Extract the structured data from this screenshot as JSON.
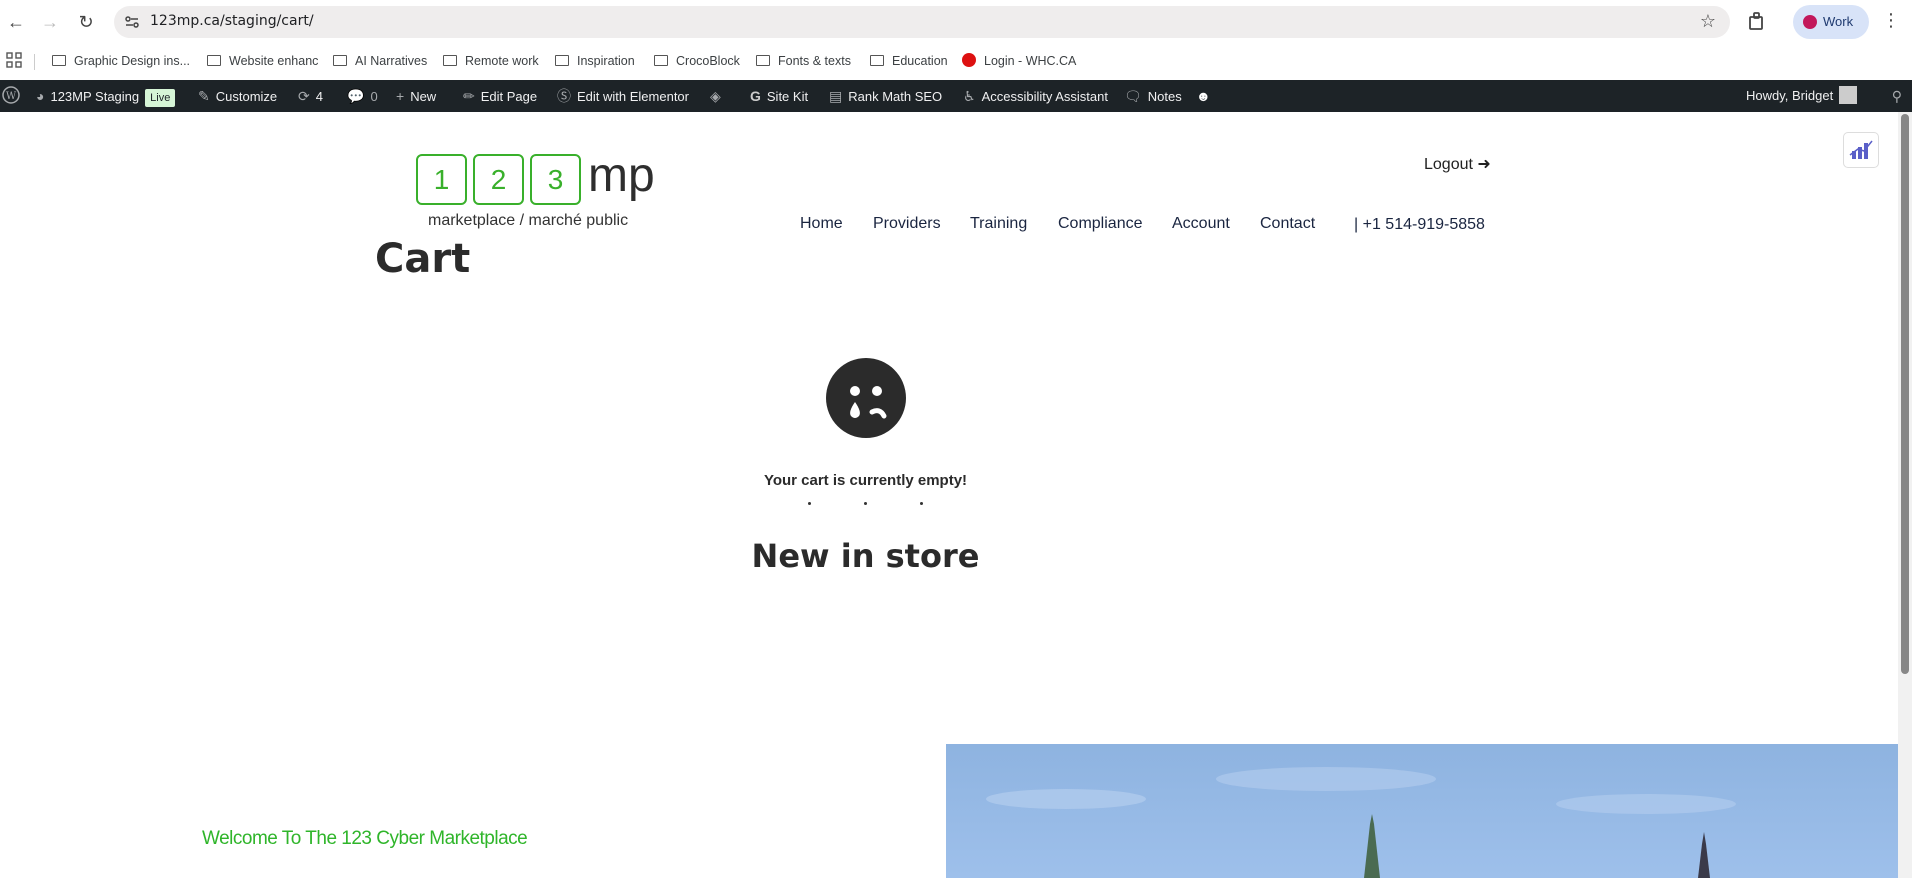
{
  "browser": {
    "url": "123mp.ca/staging/cart/",
    "profile_label": "Work"
  },
  "bookmarks": [
    {
      "label": "Graphic Design ins...",
      "type": "folder"
    },
    {
      "label": "Website enhanc",
      "type": "folder"
    },
    {
      "label": "AI Narratives",
      "type": "folder"
    },
    {
      "label": "Remote work",
      "type": "folder"
    },
    {
      "label": "Inspiration",
      "type": "folder"
    },
    {
      "label": "CrocoBlock",
      "type": "folder"
    },
    {
      "label": "Fonts & texts",
      "type": "folder"
    },
    {
      "label": "Education",
      "type": "folder"
    },
    {
      "label": "Login - WHC.CA",
      "type": "link"
    }
  ],
  "wp_admin_bar": {
    "site_name": "123MP Staging",
    "live_badge": "Live",
    "customize": "Customize",
    "updates_count": "4",
    "comments_count": "0",
    "new": "New",
    "edit_page": "Edit Page",
    "edit_elementor": "Edit with Elementor",
    "site_kit": "Site Kit",
    "rank_math": "Rank Math SEO",
    "accessibility": "Accessibility Assistant",
    "notes": "Notes",
    "howdy": "Howdy, Bridget"
  },
  "site": {
    "logo": {
      "digits": [
        "1",
        "2",
        "3"
      ],
      "suffix": "mp",
      "tagline": "marketplace / marché public"
    },
    "logout": "Logout",
    "nav": [
      "Home",
      "Providers",
      "Training",
      "Compliance",
      "Account",
      "Contact"
    ],
    "phone": "| +1 514-919-5858"
  },
  "cart": {
    "title": "Cart",
    "empty_message": "Your cart is currently empty!",
    "section_heading": "New in store"
  },
  "footer_section": {
    "welcome": "Welcome To The 123 Cyber Marketplace"
  },
  "colors": {
    "brand_green": "#39b02b",
    "admin_bar": "#1d2327",
    "text_dark": "#2b2b2b"
  }
}
